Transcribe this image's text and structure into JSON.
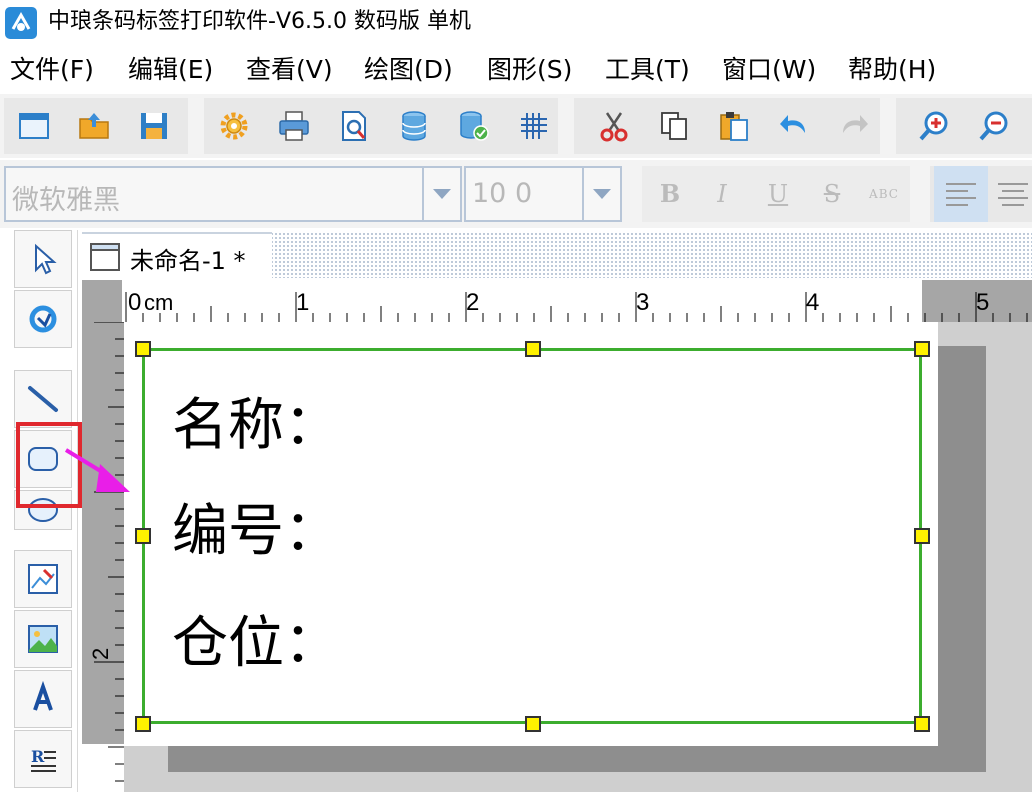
{
  "window": {
    "title": "中琅条码标签打印软件-V6.5.0 数码版 单机"
  },
  "menu": {
    "items": [
      {
        "label": "文件(F)"
      },
      {
        "label": "编辑(E)"
      },
      {
        "label": "查看(V)"
      },
      {
        "label": "绘图(D)"
      },
      {
        "label": "图形(S)"
      },
      {
        "label": "工具(T)"
      },
      {
        "label": "窗口(W)"
      },
      {
        "label": "帮助(H)"
      }
    ]
  },
  "toolbar": {
    "icons": [
      "new-document-icon",
      "open-folder-icon",
      "save-icon",
      "settings-gear-icon",
      "print-icon",
      "print-preview-icon",
      "database-icon",
      "database-link-icon",
      "grid-icon",
      "cut-icon",
      "copy-icon",
      "paste-icon",
      "undo-icon",
      "redo-icon",
      "zoom-in-icon",
      "zoom-out-icon"
    ]
  },
  "font_toolbar": {
    "font_name": "微软雅黑",
    "font_size": "10 0",
    "bold": "B",
    "italic": "I",
    "underline": "U",
    "strikethrough": "S",
    "outline": "ABC"
  },
  "toolbox": {
    "tools": [
      "select-arrow-icon",
      "rotate-icon",
      "line-icon",
      "rounded-rect-icon",
      "ellipse-icon",
      "image-edit-icon",
      "picture-icon",
      "text-icon",
      "rich-text-icon"
    ],
    "highlighted": "rounded-rect-icon"
  },
  "document": {
    "tab_label": "未命名-1 *"
  },
  "ruler": {
    "unit": "cm",
    "h_labels": [
      "0",
      "1",
      "2",
      "3",
      "4",
      "5"
    ],
    "v_labels": [
      "2"
    ]
  },
  "label": {
    "lines": [
      "名称：",
      "编号：",
      "仓位："
    ]
  },
  "colors": {
    "selection": "#3cad2e",
    "handle": "#fff200",
    "highlight": "#e0282e",
    "arrow": "#e91ee8"
  }
}
